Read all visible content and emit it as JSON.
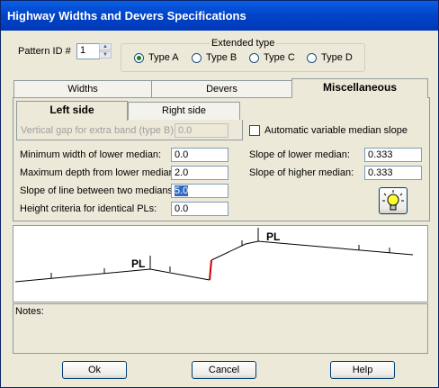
{
  "window": {
    "title": "Highway Widths and Devers Specifications"
  },
  "pattern": {
    "label": "Pattern ID #",
    "value": "1"
  },
  "extended_type": {
    "label": "Extended type",
    "options": [
      "Type A",
      "Type B",
      "Type C",
      "Type D"
    ],
    "selected": "Type A"
  },
  "tabs": [
    {
      "label": "Widths"
    },
    {
      "label": "Devers"
    },
    {
      "label": "Miscellaneous"
    }
  ],
  "active_tab": "Miscellaneous",
  "side_tabs": [
    {
      "label": "Left side"
    },
    {
      "label": "Right side"
    }
  ],
  "active_side": "Left side",
  "vertical_gap": {
    "label": "Vertical gap for extra band (type B):",
    "value": "0.0"
  },
  "auto_median": {
    "label": "Automatic variable median slope",
    "checked": false
  },
  "fields_left": [
    {
      "label": "Minimum width of lower median:",
      "value": "0.0"
    },
    {
      "label": "Maximum depth from lower median:",
      "value": "2.0"
    },
    {
      "label": "Slope of line between two medians:",
      "value": "5.0"
    },
    {
      "label": "Height criteria for identical PLs:",
      "value": "0.0"
    }
  ],
  "fields_right": [
    {
      "label": "Slope of lower median:",
      "value": "0.333"
    },
    {
      "label": "Slope of higher median:",
      "value": "0.333"
    }
  ],
  "hint_icon": "lightbulb-icon",
  "diagram": {
    "pl_label_1": "PL",
    "pl_label_2": "PL",
    "highlight_color": "#cc0000"
  },
  "notes": {
    "label": "Notes:"
  },
  "buttons": {
    "ok": "Ok",
    "cancel": "Cancel",
    "help": "Help"
  }
}
